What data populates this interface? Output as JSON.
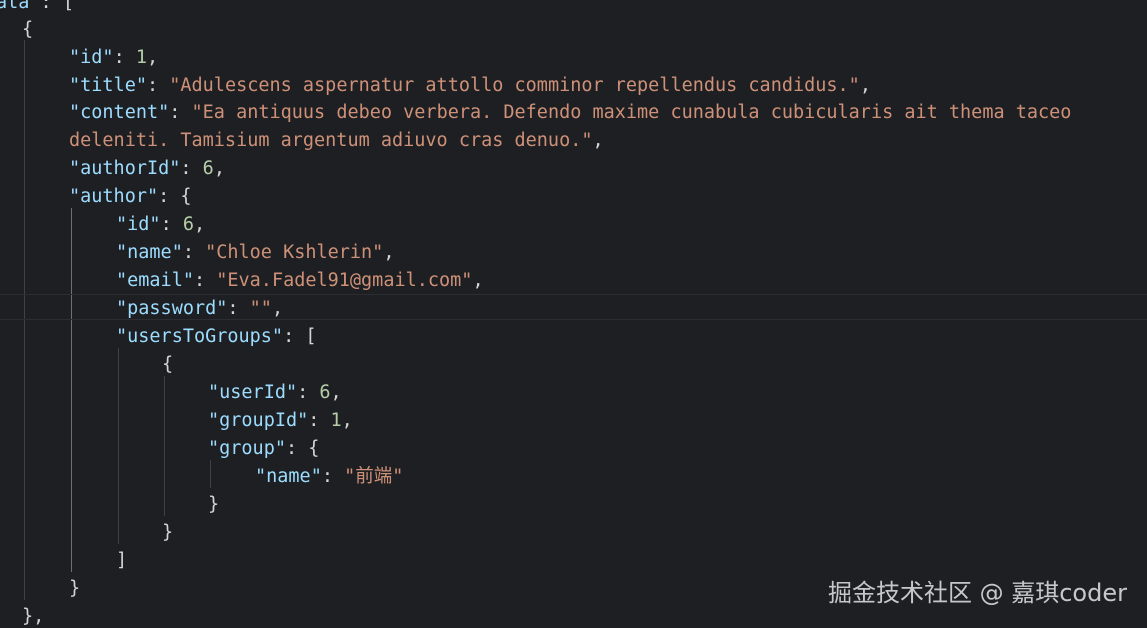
{
  "lines": [
    {
      "top_prefix": "",
      "parts": [
        {
          "c": "k",
          "t": "ata"
        },
        {
          "c": "p",
          "t": " : ["
        }
      ]
    },
    {
      "parts": [
        {
          "c": "p",
          "t": "{"
        }
      ]
    },
    {
      "parts": [
        {
          "c": "k",
          "t": "\"id\""
        },
        {
          "c": "p",
          "t": ": "
        },
        {
          "c": "n",
          "t": "1"
        },
        {
          "c": "p",
          "t": ","
        }
      ]
    },
    {
      "parts": [
        {
          "c": "k",
          "t": "\"title\""
        },
        {
          "c": "p",
          "t": ": "
        },
        {
          "c": "s",
          "t": "\"Adulescens aspernatur attollo comminor repellendus candidus.\""
        },
        {
          "c": "p",
          "t": ","
        }
      ]
    },
    {
      "parts": [
        {
          "c": "k",
          "t": "\"content\""
        },
        {
          "c": "p",
          "t": ": "
        },
        {
          "c": "s",
          "t": "\"Ea antiquus debeo verbera. Defendo maxime cunabula cubicularis ait thema taceo"
        }
      ]
    },
    {
      "parts": [
        {
          "c": "s",
          "t": "deleniti. Tamisium argentum adiuvo cras denuo.\""
        },
        {
          "c": "p",
          "t": ","
        }
      ]
    },
    {
      "parts": [
        {
          "c": "k",
          "t": "\"authorId\""
        },
        {
          "c": "p",
          "t": ": "
        },
        {
          "c": "n",
          "t": "6"
        },
        {
          "c": "p",
          "t": ","
        }
      ]
    },
    {
      "parts": [
        {
          "c": "k",
          "t": "\"author\""
        },
        {
          "c": "p",
          "t": ": {"
        }
      ]
    },
    {
      "parts": [
        {
          "c": "k",
          "t": "\"id\""
        },
        {
          "c": "p",
          "t": ": "
        },
        {
          "c": "n",
          "t": "6"
        },
        {
          "c": "p",
          "t": ","
        }
      ]
    },
    {
      "parts": [
        {
          "c": "k",
          "t": "\"name\""
        },
        {
          "c": "p",
          "t": ": "
        },
        {
          "c": "s",
          "t": "\"Chloe Kshlerin\""
        },
        {
          "c": "p",
          "t": ","
        }
      ]
    },
    {
      "parts": [
        {
          "c": "k",
          "t": "\"email\""
        },
        {
          "c": "p",
          "t": ": "
        },
        {
          "c": "s",
          "t": "\"Eva.Fadel91@gmail.com\""
        },
        {
          "c": "p",
          "t": ","
        }
      ]
    },
    {
      "parts": [
        {
          "c": "k",
          "t": "\"password\""
        },
        {
          "c": "p",
          "t": ": "
        },
        {
          "c": "s",
          "t": "\"\""
        },
        {
          "c": "p",
          "t": ","
        }
      ]
    },
    {
      "parts": [
        {
          "c": "k",
          "t": "\"usersToGroups\""
        },
        {
          "c": "p",
          "t": ": ["
        }
      ]
    },
    {
      "parts": [
        {
          "c": "p",
          "t": "{"
        }
      ]
    },
    {
      "parts": [
        {
          "c": "k",
          "t": "\"userId\""
        },
        {
          "c": "p",
          "t": ": "
        },
        {
          "c": "n",
          "t": "6"
        },
        {
          "c": "p",
          "t": ","
        }
      ]
    },
    {
      "parts": [
        {
          "c": "k",
          "t": "\"groupId\""
        },
        {
          "c": "p",
          "t": ": "
        },
        {
          "c": "n",
          "t": "1"
        },
        {
          "c": "p",
          "t": ","
        }
      ]
    },
    {
      "parts": [
        {
          "c": "k",
          "t": "\"group\""
        },
        {
          "c": "p",
          "t": ": {"
        }
      ]
    },
    {
      "parts": [
        {
          "c": "k",
          "t": "\"name\""
        },
        {
          "c": "p",
          "t": ": "
        },
        {
          "c": "s",
          "t": "\"前端\""
        }
      ]
    },
    {
      "parts": [
        {
          "c": "p",
          "t": "}"
        }
      ]
    },
    {
      "parts": [
        {
          "c": "p",
          "t": "}"
        }
      ]
    },
    {
      "parts": [
        {
          "c": "p",
          "t": "]"
        }
      ]
    },
    {
      "parts": [
        {
          "c": "p",
          "t": "}"
        }
      ]
    },
    {
      "parts": [
        {
          "c": "p",
          "t": "},"
        }
      ]
    }
  ],
  "watermark": "掘金技术社区 @ 嘉琪coder"
}
